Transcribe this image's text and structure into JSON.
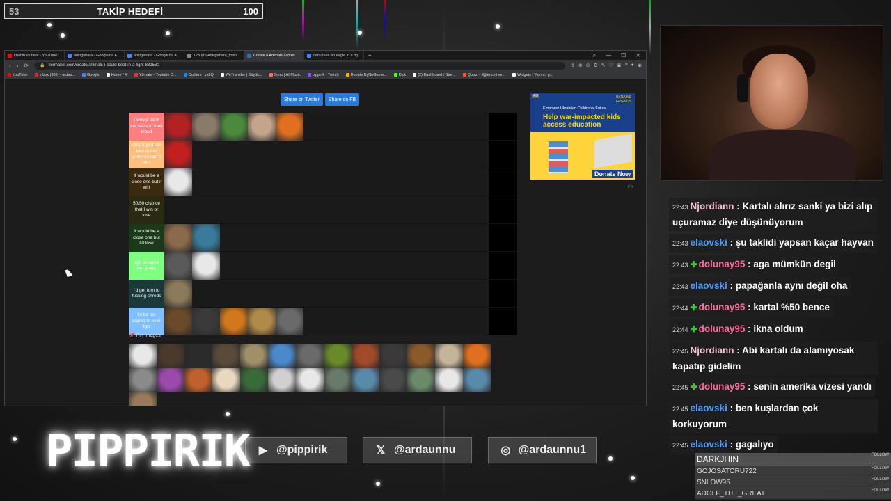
{
  "follow_goal": {
    "current": "53",
    "title": "TAKİP HEDEFİ",
    "target": "100"
  },
  "browser": {
    "tabs": [
      {
        "label": "khabib vs bear - YouTube",
        "color": "#ff0000"
      },
      {
        "label": "aokigahara - Google'da A",
        "color": "#4285f4"
      },
      {
        "label": "aokigahara - Google'da A",
        "color": "#4285f4"
      },
      {
        "label": "1280px-Aokigahara_fores",
        "color": "#888888"
      },
      {
        "label": "Create a Animals I could",
        "color": "#3a6ea5",
        "active": true
      },
      {
        "label": "can i take an eagle in a fig",
        "color": "#4285f4"
      }
    ],
    "new_tab": "+",
    "window_controls": [
      "⌕",
      "—",
      "☐",
      "✕"
    ],
    "nav_icons": [
      "‹",
      "›",
      "⟳"
    ],
    "url": "tiermaker.com/create/animals-i-could-beat-in-a-fight-832530",
    "extension_icons": [
      "⇪",
      "⊕",
      "⊖",
      "⚙",
      "✎",
      "♡",
      "▣",
      "≡",
      "●",
      "◉"
    ],
    "bookmarks": [
      {
        "label": "YouTube",
        "color": "#ff0000"
      },
      {
        "label": "Inbox (936) - ardau...",
        "color": "#d93025"
      },
      {
        "label": "Google",
        "color": "#4285f4"
      },
      {
        "label": "Home / X",
        "color": "#ffffff"
      },
      {
        "label": "Y2mate - Youtube D...",
        "color": "#e53935"
      },
      {
        "label": "Outliers | vidIQ",
        "color": "#1e88e5"
      },
      {
        "label": "WeTransfer | Büyük...",
        "color": "#ffffff"
      },
      {
        "label": "Suno | AI Music",
        "color": "#ff7043"
      },
      {
        "label": "pippirik - Twitch",
        "color": "#9146ff"
      },
      {
        "label": "Donate ByNoGame...",
        "color": "#ffb300"
      },
      {
        "label": "Kick",
        "color": "#53fc18"
      },
      {
        "label": "(2) Dashboard / Stre...",
        "color": "#ffffff"
      },
      {
        "label": "Quizzi - Eğlenceli ve...",
        "color": "#ff5722"
      },
      {
        "label": "Widgets | Yayıncı g...",
        "color": "#ffffff"
      }
    ]
  },
  "page": {
    "share_twitter": "Share on Twitter",
    "share_fb": "Share on FB",
    "pin_images": "Pin Images",
    "tiers": [
      {
        "label": "I would paint the walls in their blood",
        "color": "#ff7f7f",
        "animals": [
          "#b22222",
          "#8a7a6a",
          "#4a8a3a",
          "#c4a48a",
          "#e07020"
        ]
      },
      {
        "label": "Only a god has luck in the universe can ir win",
        "color": "#ffbf7f",
        "animals": [
          "#c02020"
        ]
      },
      {
        "label": "It would be a close one but if win",
        "color": "#3a2a10",
        "animals": [
          "#e8e8e8"
        ]
      },
      {
        "label": "50/50 chance that I win or lose",
        "color": "#2a2a10",
        "animals": []
      },
      {
        "label": "It would be a close one but I'd lose",
        "color": "#1a3a1a",
        "animals": [
          "#8a6a4a",
          "#3a7a9a"
        ]
      },
      {
        "label": "ugh oh we're not going",
        "color": "#7fff7f",
        "animals": [
          "#5a5a5a",
          "#e8e8e8"
        ]
      },
      {
        "label": "I'd get torn to fucking shreds",
        "color": "#1a3a3a",
        "animals": [
          "#8a7a5a"
        ]
      },
      {
        "label": "I'd be too scared to even fight",
        "color": "#7fbfff",
        "animals": [
          "#6a4a2a",
          "#3a3a3a",
          "#d0781a",
          "#b08a4a",
          "#6a6a6a"
        ]
      }
    ],
    "pool": [
      "#e8e8e8",
      "#4a3a2a",
      "#2a2a2a",
      "#5a4a3a",
      "#a0906a",
      "#4a8aca",
      "#6a6a6a",
      "#6a8a2a",
      "#a04a2a",
      "#3a3a3a",
      "#8a5a2a",
      "#c4b49a",
      "#e07020",
      "#8a8a8a",
      "#9a4aaa",
      "#c0602a",
      "#e8d8c0",
      "#3a6a3a",
      "#d0d0d0",
      "#e8e8e8",
      "#6a7a6a",
      "#5a8aaa",
      "#4a4a4a",
      "#6a8a6a",
      "#e8e8e8",
      "#5a8aaa",
      "#9a7a5a"
    ]
  },
  "ad": {
    "tag": "AD",
    "logo": "UKRAINE FRIENDS",
    "subtitle": "Empower Ukrainian Children's Future",
    "headline": "Help war-impacted kids access education",
    "button": "Donate Now",
    "footer": "PN"
  },
  "chat": [
    {
      "time": "22:43",
      "user": "Njordiann",
      "color": "#f4c2d0",
      "badge": false,
      "text": "Kartalı alırız sanki ya bizi alıp uçuramaz diye düşünüyorum"
    },
    {
      "time": "22:43",
      "user": "elaovski",
      "color": "#4a9cff",
      "badge": false,
      "text": "şu taklidi yapsan kaçar hayvan"
    },
    {
      "time": "22:43",
      "user": "dolunay95",
      "color": "#ff6b9a",
      "badge": true,
      "text": "aga mümkün degil"
    },
    {
      "time": "22:43",
      "user": "elaovski",
      "color": "#4a9cff",
      "badge": false,
      "text": "papağanla aynı değil oha"
    },
    {
      "time": "22:44",
      "user": "dolunay95",
      "color": "#ff6b9a",
      "badge": true,
      "text": "kartal %50 bence"
    },
    {
      "time": "22:44",
      "user": "dolunay95",
      "color": "#ff6b9a",
      "badge": true,
      "text": "ikna oldum"
    },
    {
      "time": "22:45",
      "user": "Njordiann",
      "color": "#f4c2d0",
      "badge": false,
      "text": "Abi kartalı da alamıyosak kapatıp gidelim"
    },
    {
      "time": "22:45",
      "user": "dolunay95",
      "color": "#ff6b9a",
      "badge": true,
      "text": "senin amerika vizesi yandı"
    },
    {
      "time": "22:45",
      "user": "elaovski",
      "color": "#4a9cff",
      "badge": false,
      "text": "ben kuşlardan çok korkuyorum"
    },
    {
      "time": "22:45",
      "user": "elaovski",
      "color": "#4a9cff",
      "badge": false,
      "text": "gagalıyo"
    }
  ],
  "logo": "PIPPIRIK",
  "socials": [
    {
      "icon": "youtube-icon",
      "glyph": "▶",
      "handle": "@pippirik"
    },
    {
      "icon": "x-icon",
      "glyph": "𝕏",
      "handle": "@ardaunnu"
    },
    {
      "icon": "instagram-icon",
      "glyph": "◎",
      "handle": "@ardaunnu1"
    }
  ],
  "followers": {
    "badge": "FOLLOW",
    "names": [
      "DARKJHIN",
      "GOJOSATORU722",
      "SNLOW95",
      "ADOLF_THE_GREAT"
    ]
  }
}
